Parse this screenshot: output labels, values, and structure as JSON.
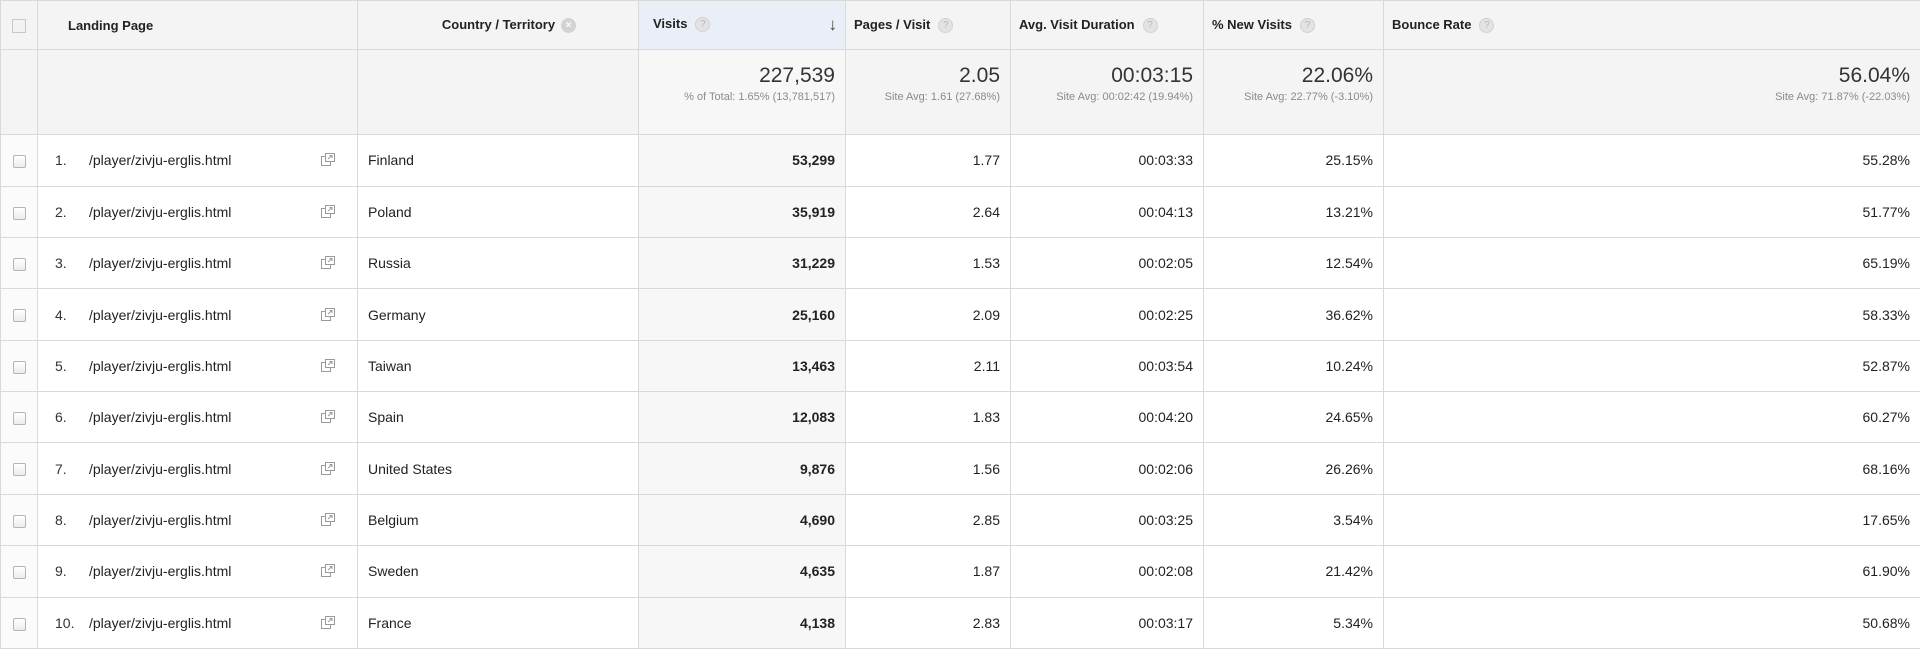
{
  "headers": {
    "landing_page": "Landing Page",
    "country": "Country / Territory",
    "visits": "Visits",
    "pages_per_visit": "Pages / Visit",
    "avg_duration": "Avg. Visit Duration",
    "new_visits": "% New Visits",
    "bounce_rate": "Bounce Rate",
    "help_glyph": "?",
    "remove_glyph": "×",
    "sort_glyph": "↓"
  },
  "totals": {
    "visits": {
      "value": "227,539",
      "sub": "% of Total: 1.65% (13,781,517)"
    },
    "pages_per_visit": {
      "value": "2.05",
      "sub": "Site Avg: 1.61 (27.68%)"
    },
    "avg_duration": {
      "value": "00:03:15",
      "sub": "Site Avg: 00:02:42 (19.94%)"
    },
    "new_visits": {
      "value": "22.06%",
      "sub": "Site Avg: 22.77% (-3.10%)"
    },
    "bounce_rate": {
      "value": "56.04%",
      "sub": "Site Avg: 71.87% (-22.03%)"
    }
  },
  "rows": [
    {
      "rank": "1.",
      "page": "/player/zivju-erglis.html",
      "country": "Finland",
      "visits": "53,299",
      "ppv": "1.77",
      "duration": "00:03:33",
      "new_visits": "25.15%",
      "bounce": "55.28%"
    },
    {
      "rank": "2.",
      "page": "/player/zivju-erglis.html",
      "country": "Poland",
      "visits": "35,919",
      "ppv": "2.64",
      "duration": "00:04:13",
      "new_visits": "13.21%",
      "bounce": "51.77%"
    },
    {
      "rank": "3.",
      "page": "/player/zivju-erglis.html",
      "country": "Russia",
      "visits": "31,229",
      "ppv": "1.53",
      "duration": "00:02:05",
      "new_visits": "12.54%",
      "bounce": "65.19%"
    },
    {
      "rank": "4.",
      "page": "/player/zivju-erglis.html",
      "country": "Germany",
      "visits": "25,160",
      "ppv": "2.09",
      "duration": "00:02:25",
      "new_visits": "36.62%",
      "bounce": "58.33%"
    },
    {
      "rank": "5.",
      "page": "/player/zivju-erglis.html",
      "country": "Taiwan",
      "visits": "13,463",
      "ppv": "2.11",
      "duration": "00:03:54",
      "new_visits": "10.24%",
      "bounce": "52.87%"
    },
    {
      "rank": "6.",
      "page": "/player/zivju-erglis.html",
      "country": "Spain",
      "visits": "12,083",
      "ppv": "1.83",
      "duration": "00:04:20",
      "new_visits": "24.65%",
      "bounce": "60.27%"
    },
    {
      "rank": "7.",
      "page": "/player/zivju-erglis.html",
      "country": "United States",
      "visits": "9,876",
      "ppv": "1.56",
      "duration": "00:02:06",
      "new_visits": "26.26%",
      "bounce": "68.16%"
    },
    {
      "rank": "8.",
      "page": "/player/zivju-erglis.html",
      "country": "Belgium",
      "visits": "4,690",
      "ppv": "2.85",
      "duration": "00:03:25",
      "new_visits": "3.54%",
      "bounce": "17.65%"
    },
    {
      "rank": "9.",
      "page": "/player/zivju-erglis.html",
      "country": "Sweden",
      "visits": "4,635",
      "ppv": "1.87",
      "duration": "00:02:08",
      "new_visits": "21.42%",
      "bounce": "61.90%"
    },
    {
      "rank": "10.",
      "page": "/player/zivju-erglis.html",
      "country": "France",
      "visits": "4,138",
      "ppv": "2.83",
      "duration": "00:03:17",
      "new_visits": "5.34%",
      "bounce": "50.68%"
    }
  ]
}
